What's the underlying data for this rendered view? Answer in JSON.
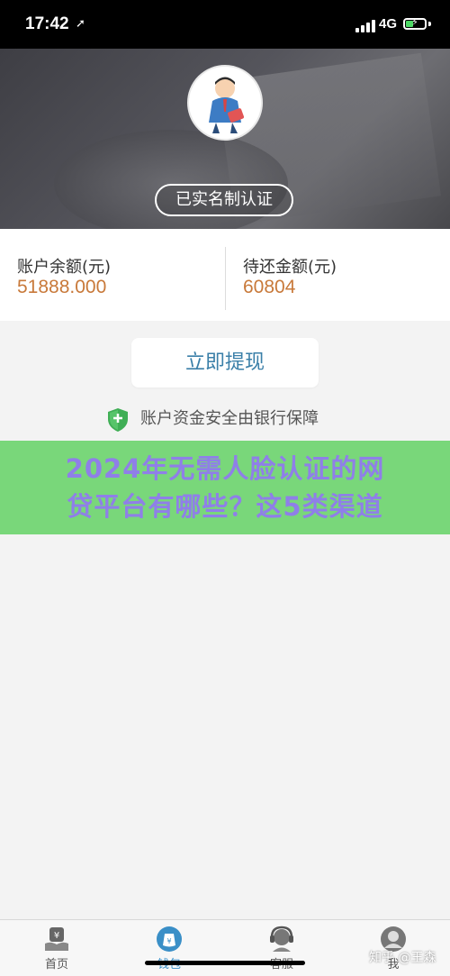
{
  "status_bar": {
    "time": "17:42",
    "location_glyph": "➚",
    "network": "4G",
    "battery_level": 0.35,
    "battery_icon": "⚡"
  },
  "profile": {
    "avatar": "cartoon-businessman-avatar",
    "verify_badge": "已实名制认证"
  },
  "balances": {
    "account_label": "账户余额(元)",
    "account_value": "51888.000",
    "pending_label": "待还金额(元)",
    "pending_value": "60804",
    "value_color": "#c8793a"
  },
  "actions": {
    "withdraw_label": "立即提现"
  },
  "security": {
    "icon": "shield-icon",
    "text": "账户资金安全由银行保障"
  },
  "overlay": {
    "line1": "2024年无需人脸认证的网",
    "line2": "贷平台有哪些？这5类渠道",
    "background": "#79d77a",
    "text_color": "#8f7fe8"
  },
  "tabs": [
    {
      "label": "首页",
      "icon": "home-yen-icon",
      "active": false
    },
    {
      "label": "钱包",
      "icon": "wallet-icon",
      "active": true
    },
    {
      "label": "客服",
      "icon": "customer-service-icon",
      "active": false
    },
    {
      "label": "我",
      "icon": "profile-icon",
      "active": false
    }
  ],
  "watermark": "知乎 @王森",
  "colors": {
    "accent": "#3a8fc7",
    "button_text": "#3a7fa8"
  }
}
